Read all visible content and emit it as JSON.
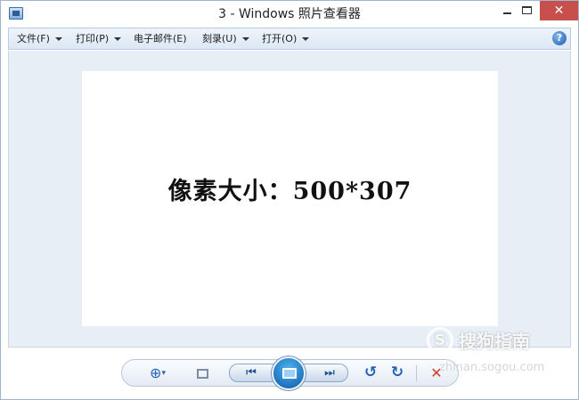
{
  "window": {
    "title": "3 - Windows 照片查看器",
    "minimize_label": "",
    "maximize_label": "",
    "close_label": "✕"
  },
  "menu": {
    "items": [
      {
        "label": "文件(F)"
      },
      {
        "label": "打印(P)"
      },
      {
        "label": "电子邮件(E)"
      },
      {
        "label": "刻录(U)"
      },
      {
        "label": "打开(O)"
      }
    ],
    "help_label": "?"
  },
  "photo": {
    "text": "像素大小：500*307"
  },
  "toolbar": {
    "zoom_icon": "⊕",
    "prev_icon": "⏮",
    "next_icon": "⏭",
    "rotate_ccw_icon": "↺",
    "rotate_cw_icon": "↻",
    "delete_icon": "✕",
    "icons": [
      "zoom-icon",
      "fit-to-window-icon",
      "previous-icon",
      "slideshow-icon",
      "next-icon",
      "rotate-counterclockwise-icon",
      "rotate-clockwise-icon",
      "delete-icon"
    ]
  },
  "watermark": {
    "logo_char": "S",
    "title": "搜狗指南",
    "url": "zhinan.sogou.com"
  },
  "colors": {
    "accent": "#2563b5",
    "close_button": "#c7504c",
    "delete": "#d23a2e",
    "viewer_background": "#e8eef6"
  }
}
